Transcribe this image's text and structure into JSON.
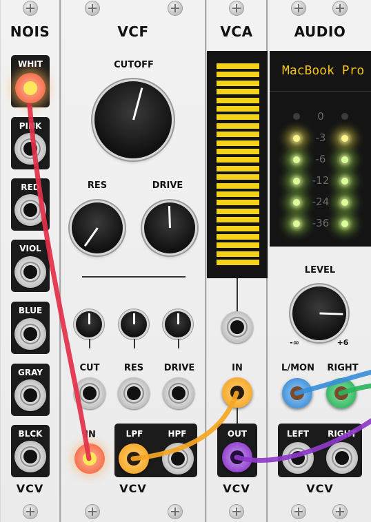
{
  "modules": {
    "noise": {
      "title": "NOIS",
      "brand": "VCV",
      "outputs": [
        "WHIT",
        "PINK",
        "RED",
        "VIOL",
        "BLUE",
        "GRAY",
        "BLCK"
      ]
    },
    "vcf": {
      "title": "VCF",
      "brand": "VCV",
      "cutoff_label": "CUTOFF",
      "res_label": "RES",
      "drive_label": "DRIVE",
      "cv_labels": [
        "CUT",
        "RES",
        "DRIVE"
      ],
      "in_label": "IN",
      "lpf_label": "LPF",
      "hpf_label": "HPF"
    },
    "vca": {
      "title": "VCA",
      "brand": "VCV",
      "in_label": "IN",
      "out_label": "OUT",
      "meter_level_fraction": 1.0
    },
    "audio": {
      "title": "AUDIO",
      "brand": "VCV",
      "device_name": "MacBook Pro",
      "db_labels": [
        "0",
        "-3",
        "-6",
        "-12",
        "-24",
        "-36"
      ],
      "level_label": "LEVEL",
      "level_min": "-∞",
      "level_max": "+6",
      "in_labels": [
        "L/MON",
        "RIGHT"
      ],
      "out_labels": [
        "LEFT",
        "RIGHT"
      ]
    }
  },
  "colors": {
    "panel": "#ededed",
    "cable_red": "#e2304a",
    "cable_orange": "#f5a623",
    "cable_purple": "#8d39c9",
    "cable_blue": "#3b8fd9",
    "cable_green": "#2db55d",
    "meter_yellow": "#f5d21a",
    "led_green": "#9be24a",
    "led_yellow": "#f2e040",
    "device_text": "#f3c21b"
  },
  "icons": [
    "screw-icon"
  ]
}
